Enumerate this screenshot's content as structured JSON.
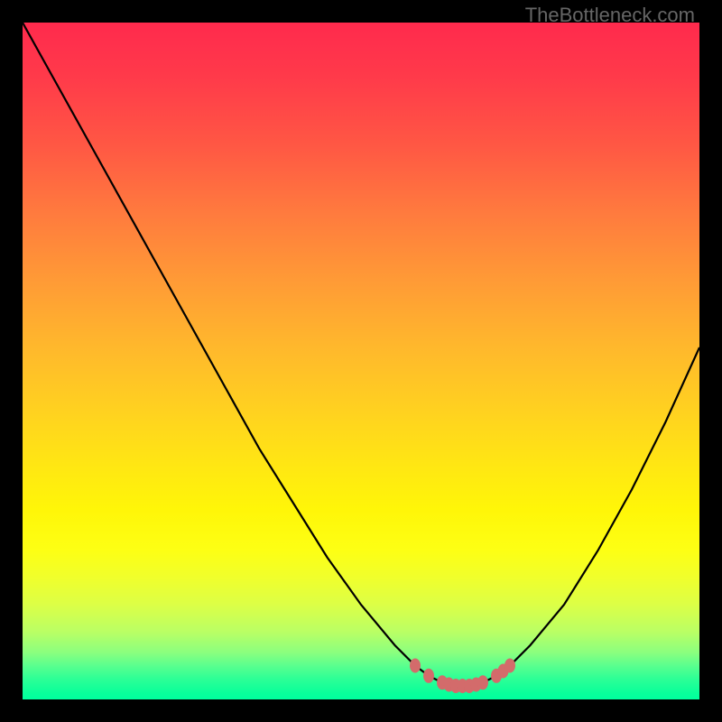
{
  "watermark": "TheBottleneck.com",
  "chart_data": {
    "type": "line",
    "title": "",
    "xlabel": "",
    "ylabel": "",
    "xlim": [
      0,
      100
    ],
    "ylim": [
      0,
      100
    ],
    "x": [
      0,
      5,
      10,
      15,
      20,
      25,
      30,
      35,
      40,
      45,
      50,
      55,
      58,
      60,
      62,
      64,
      66,
      68,
      70,
      72,
      75,
      80,
      85,
      90,
      95,
      100
    ],
    "values": [
      100,
      91,
      82,
      73,
      64,
      55,
      46,
      37,
      29,
      21,
      14,
      8,
      5,
      3.5,
      2.5,
      2,
      2,
      2.5,
      3.5,
      5,
      8,
      14,
      22,
      31,
      41,
      52
    ],
    "flat_zone": {
      "x": [
        58,
        60,
        62,
        63,
        64,
        65,
        66,
        67,
        68,
        70,
        71,
        72
      ],
      "values": [
        5,
        3.5,
        2.5,
        2.2,
        2,
        2,
        2,
        2.2,
        2.5,
        3.5,
        4.2,
        5
      ]
    },
    "flat_color": "#d36b6b",
    "curve_color": "#000000"
  }
}
